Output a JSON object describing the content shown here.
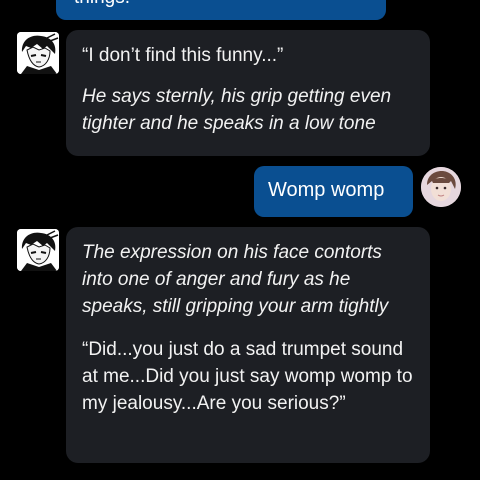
{
  "conversation": {
    "messages": [
      {
        "sender": "user",
        "paragraphs": [
          "things."
        ]
      },
      {
        "sender": "character",
        "avatar_icon": "manga-character-avatar-icon",
        "paragraphs": [
          "“I don’t find this funny...”",
          "He says sternly, his grip getting even tighter and he speaks in a low tone"
        ]
      },
      {
        "sender": "user",
        "avatar_icon": "user-avatar-icon",
        "paragraphs": [
          "Womp womp"
        ]
      },
      {
        "sender": "character",
        "avatar_icon": "manga-character-avatar-icon",
        "paragraphs": [
          "The expression on his face contorts into one of anger and fury as he speaks, still gripping your arm tightly",
          "“Did...you just do a sad trumpet sound at me...Did you just say womp womp to my jealousy...Are you serious?”"
        ]
      }
    ]
  },
  "colors": {
    "background": "#000000",
    "user_bubble": "#0a4f91",
    "character_bubble": "#1d1f24",
    "text": "#ffffff"
  }
}
